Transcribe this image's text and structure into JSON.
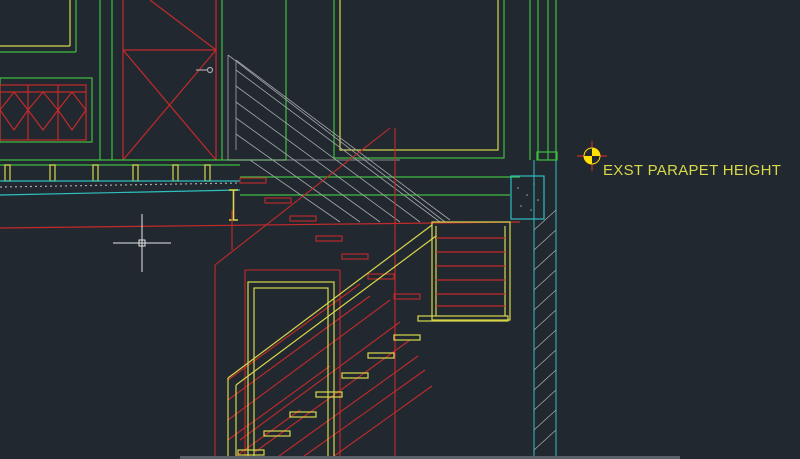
{
  "drawing": {
    "annotation_text": "EXST PARAPET HEIGHT"
  },
  "colors": {
    "background": "#212830",
    "green": "#3fbf3f",
    "red": "#c42a2a",
    "yellow": "#d8d84a",
    "cyan": "#2fbfbf",
    "gray": "#a8a8a8",
    "white": "#e6e6e6",
    "marker_yellow": "#ffe000"
  },
  "icons": {
    "crosshair": "crosshair-cursor-icon",
    "elevation_marker": "elevation-marker-icon"
  }
}
